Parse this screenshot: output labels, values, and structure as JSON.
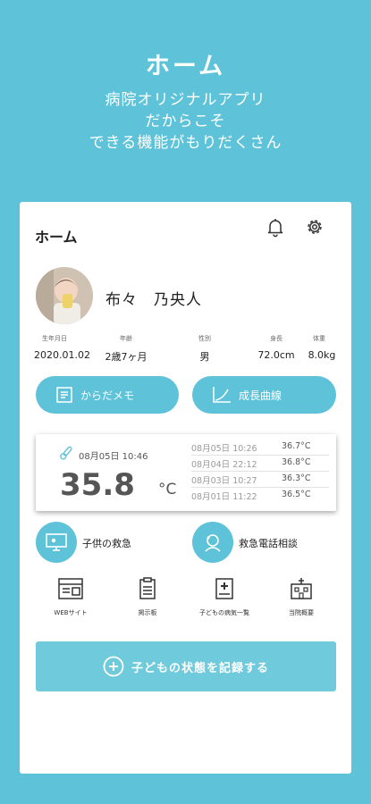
{
  "hero": {
    "title": "ホーム",
    "subtitle_lines": [
      "病院オリジナルアプリ",
      "だからこそ",
      "できる機能がもりだくさん"
    ]
  },
  "header": {
    "title": "ホーム",
    "icons": [
      "bell-icon",
      "gear-icon"
    ]
  },
  "profile": {
    "name": "布々　乃央人",
    "stats": [
      {
        "label": "生年月日",
        "value": "2020.01.02"
      },
      {
        "label": "年齢",
        "value": "2歳7ヶ月"
      },
      {
        "label": "性別",
        "value": "男"
      },
      {
        "label": "身長",
        "value": "72.0cm"
      },
      {
        "label": "体重",
        "value": "8.0kg"
      }
    ]
  },
  "actions": {
    "body_memo": "からだメモ",
    "growth_curve": "成長曲線"
  },
  "temperature": {
    "latest_datetime": "08月05日 10:46",
    "latest_value": "35.8",
    "unit": "°C",
    "history": [
      {
        "datetime": "08月05日 10:26",
        "value": "36.7°C"
      },
      {
        "datetime": "08月04日 22:12",
        "value": "36.8°C"
      },
      {
        "datetime": "08月03日 10:27",
        "value": "36.3°C"
      },
      {
        "datetime": "08月01日 11:22",
        "value": "36.5°C"
      }
    ]
  },
  "emergency": {
    "child_emergency": "子供の救急",
    "phone_consult": "救急電話相談"
  },
  "grid": {
    "web": "WEBサイト",
    "notice": "掲示板",
    "diseases": "子どもの病気一覧",
    "hospital": "当院概要"
  },
  "record": {
    "label": "子どもの状態を記録する"
  },
  "colors": {
    "accent": "#5ec3d9",
    "text": "#222222"
  }
}
